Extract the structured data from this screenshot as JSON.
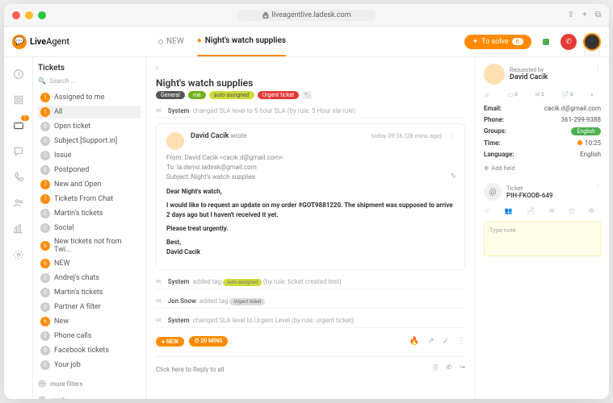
{
  "url": "liveagentlive.ladesk.com",
  "logo": "LiveAgent",
  "tabs": {
    "new": "NEW",
    "active": "Night's watch supplies"
  },
  "solve": {
    "label": "To solve",
    "count": "6"
  },
  "sidebar": {
    "title": "Tickets",
    "search": "Search ...",
    "filters": [
      {
        "count": "1",
        "label": "Assigned to me"
      },
      {
        "count": "1",
        "label": "All"
      },
      {
        "count": "0",
        "label": "Open ticket",
        "gray": true
      },
      {
        "count": "0",
        "label": "Subject [Support.in]",
        "gray": true
      },
      {
        "count": "0",
        "label": "Issue",
        "gray": true
      },
      {
        "count": "0",
        "label": "Postponed",
        "gray": true
      },
      {
        "count": "7",
        "label": "New and Open"
      },
      {
        "count": "7",
        "label": "Tickets From Chat"
      },
      {
        "count": "0",
        "label": "Martin's tickets",
        "gray": true
      },
      {
        "count": "0",
        "label": "Social",
        "gray": true
      },
      {
        "count": "6",
        "label": "New tickets not from Twi..."
      },
      {
        "count": "6",
        "label": "NEW"
      },
      {
        "count": "0",
        "label": "Andrej's chats",
        "gray": true
      },
      {
        "count": "0",
        "label": "Martin's tickets",
        "gray": true
      },
      {
        "count": "0",
        "label": "Partner A filter",
        "gray": true
      },
      {
        "count": "6",
        "label": "New"
      },
      {
        "count": "0",
        "label": "Phone calls",
        "gray": true
      },
      {
        "count": "0",
        "label": "Facebook tickets",
        "gray": true
      },
      {
        "count": "0",
        "label": "Your job",
        "gray": true
      }
    ],
    "more": "more filters",
    "create": "create"
  },
  "ticket": {
    "title": "Night's watch supplies",
    "tags": {
      "general": "General",
      "me": "me",
      "auto": "auto-assigned",
      "urgent": "Urgent ticket"
    },
    "sysUser": "System",
    "sys1": "changed SLA level to 5 hour SLA (by rule:",
    "sys1rule": "5 Hour sla rule",
    "msg": {
      "author": "David Cacik",
      "wrote": "wrote",
      "time": "today 09:56 (28 mins ago)",
      "from": "From: David Cacik <cacik.d@gmail.com>",
      "to": "To: la.demo.ladesk@gmail.com",
      "subject": "Subject: Night's watch supplies",
      "salute": "Dear Night's watch,",
      "body": "I would like to request an update on my order #GOT9881220. The shipment was supposed to arrive 2 days ago but I haven't received it yet.",
      "treat": "Please treat urgently.",
      "sign1": "Best,",
      "sign2": "David Cacik"
    },
    "sys2a": "added tag",
    "sys2tag": "auto-assigned",
    "sys2b": "(by rule: ticket created test)",
    "jon": "Jon Snow",
    "sys3a": "added tag",
    "sys3tag": "Urgent ticket",
    "sys4": "changed SLA level to Urgent Level (by rule:",
    "sys4rule": "urgent ticket",
    "status": {
      "new": "NEW",
      "mins": "20 MINS"
    },
    "reply": "Click here to Reply to all"
  },
  "right": {
    "req": "Requested by",
    "name": "David Cacik",
    "counts": {
      "c1": "0",
      "c2": "2",
      "c3": "0"
    },
    "fields": {
      "email_l": "Email:",
      "email_v": "cacik.d@gmail.com",
      "phone_l": "Phone:",
      "phone_v": "361-299-9388",
      "groups_l": "Groups:",
      "groups_v": "English",
      "time_l": "Time:",
      "time_v": "10:25",
      "lang_l": "Language:",
      "lang_v": "English"
    },
    "addf": "Add field",
    "tlabel": "Ticket",
    "tid": "PIH-FKOOB-649",
    "note": "Type note"
  },
  "mailBadge": "1"
}
